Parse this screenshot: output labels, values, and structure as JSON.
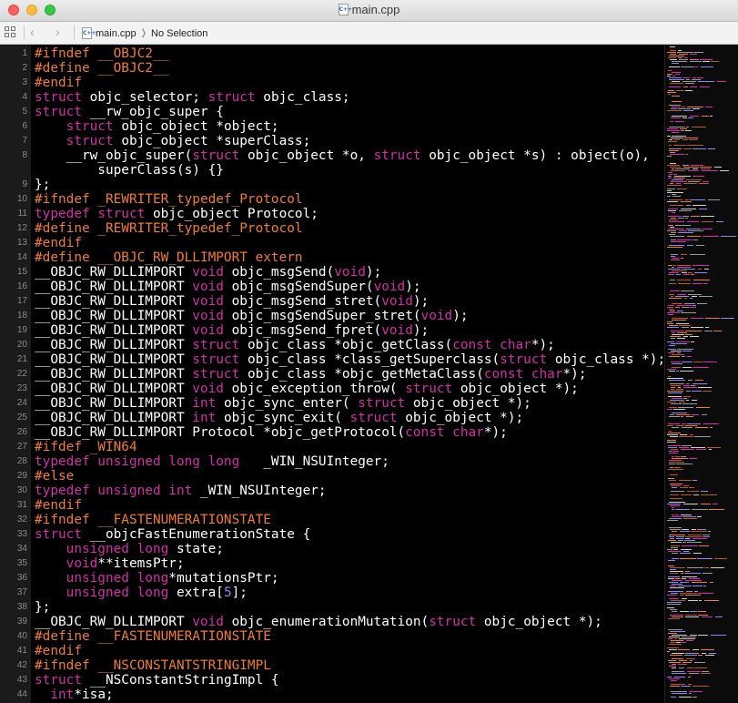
{
  "window": {
    "title": "main.cpp",
    "file_badge": "C++",
    "traffic_lights": [
      "close",
      "minimize",
      "zoom"
    ]
  },
  "jumpbar": {
    "back_glyph": "‹",
    "forward_glyph": "›",
    "file": "main.cpp",
    "chevron": "❭",
    "selection": "No Selection"
  },
  "colors": {
    "background": "#000000",
    "text": "#ffffff",
    "keyword": "#d22fa8",
    "preprocessor": "#ef7c38",
    "number": "#8f86f0",
    "line_number": "#8a8a8a"
  },
  "code_lines": [
    {
      "n": "1",
      "segs": [
        [
          "pp",
          "#ifndef __OBJC2__"
        ]
      ]
    },
    {
      "n": "2",
      "segs": [
        [
          "pp",
          "#define __OBJC2__"
        ]
      ]
    },
    {
      "n": "3",
      "segs": [
        [
          "pp",
          "#endif"
        ]
      ]
    },
    {
      "n": "4",
      "segs": [
        [
          "kw",
          "struct"
        ],
        [
          "",
          "objc_selector; "
        ],
        [
          "kw",
          "struct"
        ],
        [
          "",
          "objc_class;"
        ]
      ]
    },
    {
      "n": "5",
      "segs": [
        [
          "kw",
          "struct"
        ],
        [
          "",
          "__rw_objc_super {"
        ]
      ]
    },
    {
      "n": "6",
      "segs": [
        [
          "",
          "    "
        ],
        [
          "kw",
          "struct"
        ],
        [
          "",
          "objc_object *object;"
        ]
      ]
    },
    {
      "n": "7",
      "segs": [
        [
          "",
          "    "
        ],
        [
          "kw",
          "struct"
        ],
        [
          "",
          "objc_object *superClass;"
        ]
      ]
    },
    {
      "n": "8",
      "wrap": true,
      "segs": [
        [
          "",
          "    __rw_objc_super("
        ],
        [
          "kw",
          "struct"
        ],
        [
          "",
          "objc_object *o, "
        ],
        [
          "kw",
          "struct"
        ],
        [
          "",
          "objc_object *s) : object(o),\n        superClass(s) {}"
        ]
      ]
    },
    {
      "n": "9",
      "segs": [
        [
          "",
          "};"
        ]
      ]
    },
    {
      "n": "10",
      "segs": [
        [
          "pp",
          "#ifndef _REWRITER_typedef_Protocol"
        ]
      ]
    },
    {
      "n": "11",
      "segs": [
        [
          "kw",
          "typedef"
        ],
        [
          "kw",
          "struct"
        ],
        [
          "",
          "objc_object Protocol;"
        ]
      ]
    },
    {
      "n": "12",
      "segs": [
        [
          "pp",
          "#define _REWRITER_typedef_Protocol"
        ]
      ]
    },
    {
      "n": "13",
      "segs": [
        [
          "pp",
          "#endif"
        ]
      ]
    },
    {
      "n": "14",
      "segs": [
        [
          "pp",
          "#define __OBJC_RW_DLLIMPORT extern"
        ]
      ]
    },
    {
      "n": "15",
      "segs": [
        [
          "",
          "__OBJC_RW_DLLIMPORT "
        ],
        [
          "kw",
          "void"
        ],
        [
          "",
          "objc_msgSend("
        ],
        [
          "kw",
          "void"
        ],
        [
          "",
          "); "
        ]
      ]
    },
    {
      "n": "16",
      "segs": [
        [
          "",
          "__OBJC_RW_DLLIMPORT "
        ],
        [
          "kw",
          "void"
        ],
        [
          "",
          "objc_msgSendSuper("
        ],
        [
          "kw",
          "void"
        ],
        [
          "",
          ");"
        ]
      ]
    },
    {
      "n": "17",
      "segs": [
        [
          "",
          "__OBJC_RW_DLLIMPORT "
        ],
        [
          "kw",
          "void"
        ],
        [
          "",
          "objc_msgSend_stret("
        ],
        [
          "kw",
          "void"
        ],
        [
          "",
          ");"
        ]
      ]
    },
    {
      "n": "18",
      "segs": [
        [
          "",
          "__OBJC_RW_DLLIMPORT "
        ],
        [
          "kw",
          "void"
        ],
        [
          "",
          "objc_msgSendSuper_stret("
        ],
        [
          "kw",
          "void"
        ],
        [
          "",
          ");"
        ]
      ]
    },
    {
      "n": "19",
      "segs": [
        [
          "",
          "__OBJC_RW_DLLIMPORT "
        ],
        [
          "kw",
          "void"
        ],
        [
          "",
          "objc_msgSend_fpret("
        ],
        [
          "kw",
          "void"
        ],
        [
          "",
          ");"
        ]
      ]
    },
    {
      "n": "20",
      "segs": [
        [
          "",
          "__OBJC_RW_DLLIMPORT "
        ],
        [
          "kw",
          "struct"
        ],
        [
          "",
          "objc_class *objc_getClass("
        ],
        [
          "kw",
          "const char"
        ],
        [
          "",
          "*);"
        ]
      ]
    },
    {
      "n": "21",
      "segs": [
        [
          "",
          "__OBJC_RW_DLLIMPORT "
        ],
        [
          "kw",
          "struct"
        ],
        [
          "",
          "objc_class *class_getSuperclass("
        ],
        [
          "kw",
          "struct"
        ],
        [
          "",
          "objc_class *);"
        ]
      ]
    },
    {
      "n": "22",
      "segs": [
        [
          "",
          "__OBJC_RW_DLLIMPORT "
        ],
        [
          "kw",
          "struct"
        ],
        [
          "",
          "objc_class *objc_getMetaClass("
        ],
        [
          "kw",
          "const char"
        ],
        [
          "",
          "*);"
        ]
      ]
    },
    {
      "n": "23",
      "segs": [
        [
          "",
          "__OBJC_RW_DLLIMPORT "
        ],
        [
          "kw",
          "void"
        ],
        [
          "",
          "objc_exception_throw( "
        ],
        [
          "kw",
          "struct"
        ],
        [
          "",
          "objc_object *);"
        ]
      ]
    },
    {
      "n": "24",
      "segs": [
        [
          "",
          "__OBJC_RW_DLLIMPORT "
        ],
        [
          "kw",
          "int"
        ],
        [
          "",
          "objc_sync_enter( "
        ],
        [
          "kw",
          "struct"
        ],
        [
          "",
          "objc_object *);"
        ]
      ]
    },
    {
      "n": "25",
      "segs": [
        [
          "",
          "__OBJC_RW_DLLIMPORT "
        ],
        [
          "kw",
          "int"
        ],
        [
          "",
          "objc_sync_exit( "
        ],
        [
          "kw",
          "struct"
        ],
        [
          "",
          "objc_object *);"
        ]
      ]
    },
    {
      "n": "26",
      "segs": [
        [
          "",
          "__OBJC_RW_DLLIMPORT Protocol *objc_getProtocol("
        ],
        [
          "kw",
          "const char"
        ],
        [
          "",
          "*);"
        ]
      ]
    },
    {
      "n": "27",
      "segs": [
        [
          "pp",
          "#ifdef _WIN64"
        ]
      ]
    },
    {
      "n": "28",
      "segs": [
        [
          "kw",
          "typedef unsigned long long"
        ],
        [
          "",
          "  _WIN_NSUInteger;"
        ]
      ]
    },
    {
      "n": "29",
      "segs": [
        [
          "pp",
          "#else"
        ]
      ]
    },
    {
      "n": "30",
      "segs": [
        [
          "kw",
          "typedef unsigned int"
        ],
        [
          "",
          "_WIN_NSUInteger;"
        ]
      ]
    },
    {
      "n": "31",
      "segs": [
        [
          "pp",
          "#endif"
        ]
      ]
    },
    {
      "n": "32",
      "segs": [
        [
          "pp",
          "#ifndef __FASTENUMERATIONSTATE"
        ]
      ]
    },
    {
      "n": "33",
      "segs": [
        [
          "kw",
          "struct"
        ],
        [
          "",
          "__objcFastEnumerationState {"
        ]
      ]
    },
    {
      "n": "34",
      "segs": [
        [
          "",
          "    "
        ],
        [
          "kw",
          "unsigned long"
        ],
        [
          "",
          "state;"
        ]
      ]
    },
    {
      "n": "35",
      "segs": [
        [
          "",
          "    "
        ],
        [
          "kw",
          "void"
        ],
        [
          "",
          "**itemsPtr;"
        ]
      ]
    },
    {
      "n": "36",
      "segs": [
        [
          "",
          "    "
        ],
        [
          "kw",
          "unsigned long"
        ],
        [
          "",
          "*mutationsPtr;"
        ]
      ]
    },
    {
      "n": "37",
      "segs": [
        [
          "",
          "    "
        ],
        [
          "kw",
          "unsigned long"
        ],
        [
          "",
          "extra["
        ],
        [
          "num",
          "5"
        ],
        [
          "",
          "];"
        ]
      ]
    },
    {
      "n": "38",
      "segs": [
        [
          "",
          "};"
        ]
      ]
    },
    {
      "n": "39",
      "segs": [
        [
          "",
          "__OBJC_RW_DLLIMPORT "
        ],
        [
          "kw",
          "void"
        ],
        [
          "",
          "objc_enumerationMutation("
        ],
        [
          "kw",
          "struct"
        ],
        [
          "",
          "objc_object *);"
        ]
      ]
    },
    {
      "n": "40",
      "segs": [
        [
          "pp",
          "#define __FASTENUMERATIONSTATE"
        ]
      ]
    },
    {
      "n": "41",
      "segs": [
        [
          "pp",
          "#endif"
        ]
      ]
    },
    {
      "n": "42",
      "segs": [
        [
          "pp",
          "#ifndef __NSCONSTANTSTRINGIMPL"
        ]
      ]
    },
    {
      "n": "43",
      "segs": [
        [
          "kw",
          "struct"
        ],
        [
          "",
          "__NSConstantStringImpl {"
        ]
      ]
    },
    {
      "n": "44",
      "segs": [
        [
          "",
          "  "
        ],
        [
          "kw",
          "int"
        ],
        [
          "",
          "*isa;"
        ]
      ]
    }
  ]
}
